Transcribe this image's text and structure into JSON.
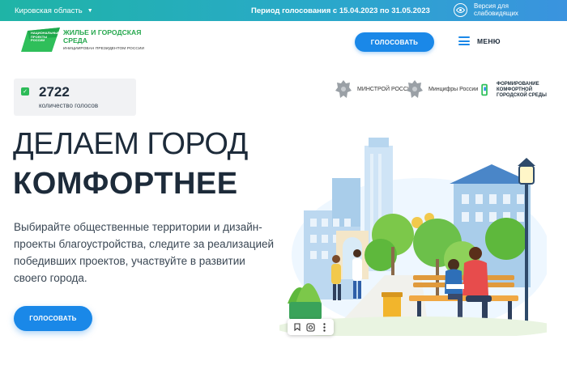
{
  "topbar": {
    "region": "Кировская область",
    "period": "Период голосования с 15.04.2023 по 31.05.2023",
    "vision_label": "Версия для слабовидящих",
    "icon": "eye-icon"
  },
  "header": {
    "logo_small": "НАЦИОНАЛЬНЫЕ ПРОЕКТЫ РОССИИ",
    "logo_title": "ЖИЛЬЕ И ГОРОДСКАЯ СРЕДА",
    "logo_sub": "ИНИЦИИРОВАН ПРЕЗИДЕНТОМ РОССИИ",
    "vote_button": "ГОЛОСОВАТЬ",
    "menu_label": "МЕНЮ"
  },
  "counter": {
    "value": "2722",
    "label": "количество голосов"
  },
  "partners": [
    {
      "name": "МИНСТРОЙ РОССИИ",
      "icon": "emblem-icon"
    },
    {
      "name": "Минцифры России",
      "icon": "emblem-icon"
    },
    {
      "name": "ФОРМИРОВАНИЕ КОМФОРТНОЙ ГОРОДСКОЙ СРЕДЫ",
      "icon": "ffgs-logo-icon"
    }
  ],
  "hero": {
    "title_line1": "ДЕЛАЕМ ГОРОД",
    "title_line2": "КОМФОРТНЕЕ",
    "lead": "Выбирайте общественные территории и дизайн-проекты благоустройства, следите за реализацией победивших проектов, участвуйте в развитии своего города.",
    "vote_button": "ГОЛОСОВАТЬ"
  },
  "colors": {
    "accent": "#1a88e8",
    "gradient_start": "#1fb4a6",
    "gradient_end": "#3a93df",
    "logo_green": "#27a84f"
  }
}
